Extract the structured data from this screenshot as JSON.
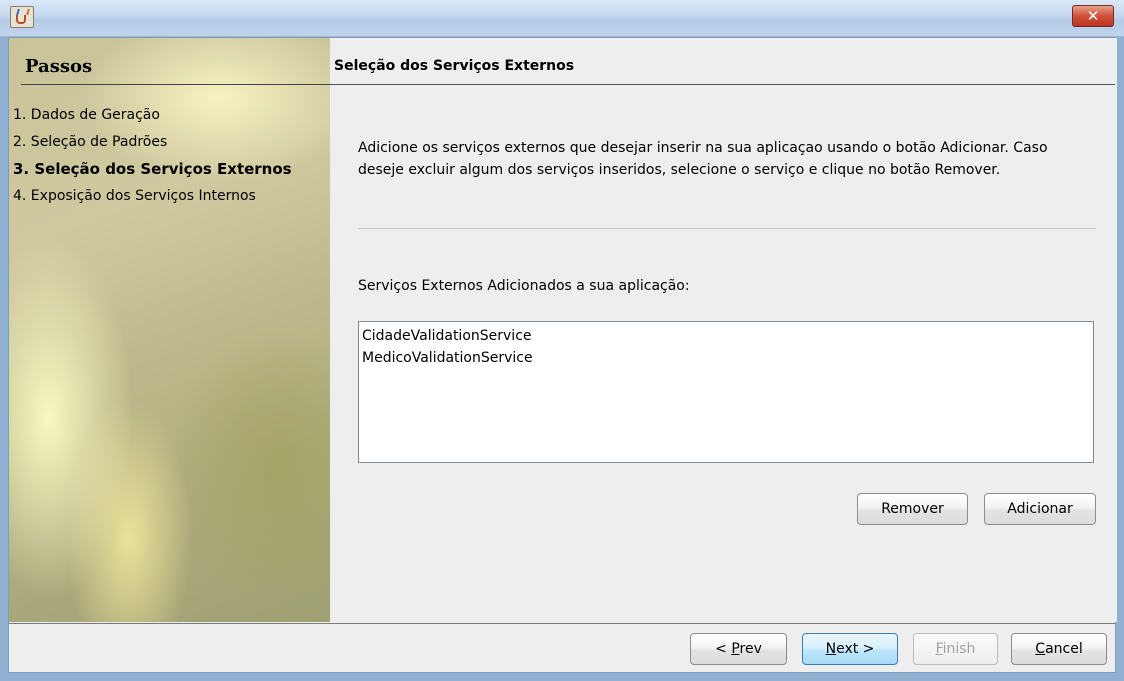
{
  "window": {
    "title": ""
  },
  "steps": {
    "title": "Passos",
    "items": [
      "1. Dados de Geração",
      "2. Seleção de Padrões",
      "3. Seleção dos Serviços Externos",
      "4. Exposição dos Serviços Internos"
    ],
    "current_index": 2
  },
  "page": {
    "title": "Seleção dos Serviços Externos",
    "description_line1": "Adicione os serviços externos que desejar inserir na sua aplicaçao usando o botão Adicionar. Caso",
    "description_line2": "deseje excluir algum dos serviços inseridos, selecione o serviço e clique no botão Remover.",
    "list_label": "Serviços Externos Adicionados a sua aplicação:",
    "services": [
      "CidadeValidationService",
      "MedicoValidationService"
    ],
    "remove_label": "Remover",
    "add_label": "Adicionar"
  },
  "nav": {
    "prev_mnemonic": "P",
    "prev_prefix": "< ",
    "prev_rest": "rev",
    "next_mnemonic": "N",
    "next_rest": "ext >",
    "finish_mnemonic": "F",
    "finish_rest": "inish",
    "cancel_mnemonic": "C",
    "cancel_rest": "ancel"
  },
  "colors": {
    "titlebar": "#c4d7ee",
    "close": "#d0523a",
    "panel": "#c9c39a"
  },
  "icons": {
    "app": "java-icon",
    "close": "close-icon"
  }
}
